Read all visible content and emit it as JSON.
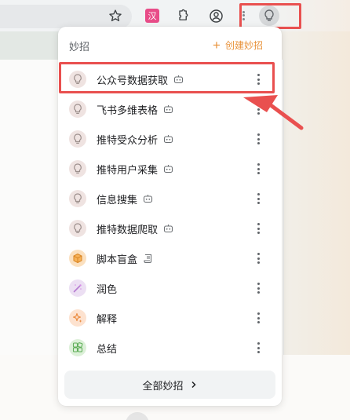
{
  "popup": {
    "title": "妙招",
    "create_label": "创建妙招",
    "footer_label": "全部妙招",
    "items": [
      {
        "label": "公众号数据获取",
        "icon": "lightbulb-icon",
        "tag": "robot-icon",
        "icon_bg": "#efe3e1"
      },
      {
        "label": "飞书多维表格",
        "icon": "lightbulb-icon",
        "tag": "robot-icon",
        "icon_bg": "#efe3e1"
      },
      {
        "label": "推特受众分析",
        "icon": "lightbulb-icon",
        "tag": "robot-icon",
        "icon_bg": "#efe3e1"
      },
      {
        "label": "推特用户采集",
        "icon": "lightbulb-icon",
        "tag": "robot-icon",
        "icon_bg": "#efe3e1"
      },
      {
        "label": "信息搜集",
        "icon": "lightbulb-icon",
        "tag": "robot-icon",
        "icon_bg": "#efe3e1"
      },
      {
        "label": "推特数据爬取",
        "icon": "lightbulb-icon",
        "tag": "robot-icon",
        "icon_bg": "#efe3e1"
      },
      {
        "label": "脚本盲盒",
        "icon": "cube-icon",
        "tag": "scroll-icon",
        "icon_bg": "#fbe0bf"
      },
      {
        "label": "润色",
        "icon": "magic-wand-icon",
        "tag": "",
        "icon_bg": "#ecdff3"
      },
      {
        "label": "解释",
        "icon": "sparkle-icon",
        "tag": "",
        "icon_bg": "#fde2cf"
      },
      {
        "label": "总结",
        "icon": "grid-icon",
        "tag": "",
        "icon_bg": "#dcf0d8"
      }
    ]
  },
  "colors": {
    "accent": "#e8923a",
    "highlight": "#e9504f",
    "text": "#202124",
    "muted": "#5f6368"
  }
}
